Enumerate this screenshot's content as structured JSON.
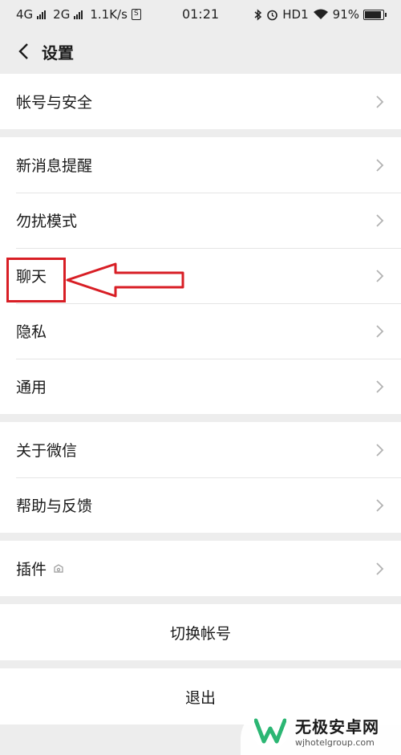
{
  "status_bar": {
    "net1": "4G",
    "net2": "2G",
    "speed": "1.1K/s",
    "sim_icon_label": "S",
    "time": "01:21",
    "hd": "HD1",
    "battery": "91%",
    "battery_level": 0.91
  },
  "header": {
    "title": "设置"
  },
  "groups": [
    {
      "items": [
        {
          "label": "帐号与安全"
        }
      ]
    },
    {
      "items": [
        {
          "label": "新消息提醒"
        },
        {
          "label": "勿扰模式"
        },
        {
          "label": "聊天"
        },
        {
          "label": "隐私"
        },
        {
          "label": "通用"
        }
      ]
    },
    {
      "items": [
        {
          "label": "关于微信"
        },
        {
          "label": "帮助与反馈"
        }
      ]
    },
    {
      "items": [
        {
          "label": "插件"
        }
      ]
    }
  ],
  "actions": {
    "switch_account": "切换帐号",
    "logout": "退出"
  },
  "annotation": {
    "color": "#d81e25",
    "target": "聊天"
  },
  "watermark": {
    "title": "无极安卓网",
    "url": "wjhotelgroup.com",
    "brand_color": "#2bb673"
  }
}
